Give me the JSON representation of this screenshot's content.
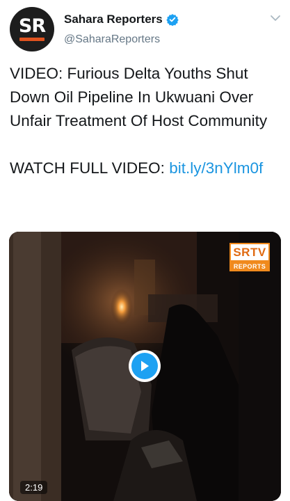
{
  "tweet": {
    "avatar_text": "SR",
    "display_name": "Sahara Reporters",
    "handle": "@SaharaReporters",
    "text": "VIDEO: Furious Delta Youths Shut Down Oil Pipeline In Ukwuani Over Unfair Treatment Of Host Community",
    "watch_prefix": "WATCH FULL VIDEO: ",
    "link_text": "bit.ly/​3nYlm0f",
    "verified_icon": "verified-badge-icon",
    "menu_icon": "chevron-down-icon",
    "accent_color": "#1b95e0"
  },
  "media": {
    "badge_top": "SRTV",
    "badge_bottom": "REPORTS",
    "duration": "2:19",
    "play_icon": "play-icon",
    "badge_color": "#f08a1d"
  }
}
